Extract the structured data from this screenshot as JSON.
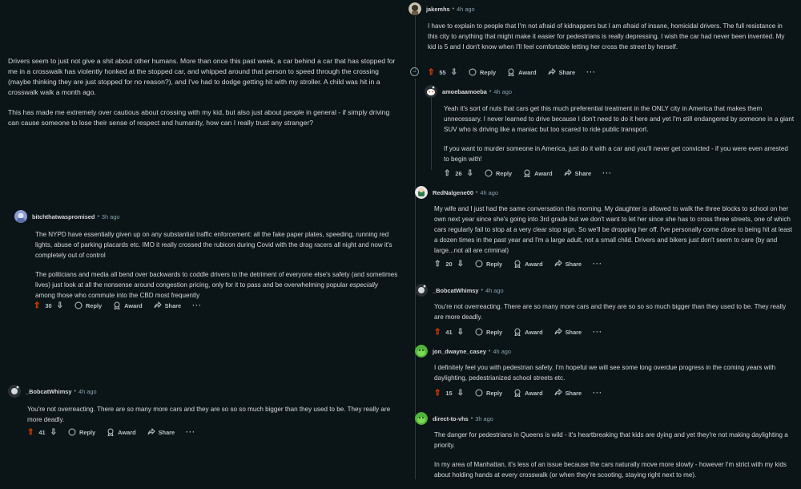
{
  "post": {
    "paragraphs": [
      "Drivers seem to just not give a shit about other humans. More than once this past week, a car behind a car that has stopped for me in a crosswalk has violently honked at the stopped car, and whipped around that person to speed through the crossing (maybe thinking they are just stopped for no reason?), and I've had to dodge getting hit with my stroller. A child was hit in a crosswalk walk a month ago.",
      "This has made me extremely over cautious about crossing with my kid, but also just about people in general - if simply driving can cause someone to lose their sense of respect and humanity, how can I really trust any stranger?"
    ]
  },
  "labels": {
    "reply": "Reply",
    "award": "Award",
    "share": "Share",
    "more": "···",
    "dot": "•",
    "collapse": "−"
  },
  "left_comments": [
    {
      "username": "bitchthatwaspromised",
      "time": "3h ago",
      "p1": "The NYPD have essentially given up on any substantial traffic enforcement: all the fake paper plates, speeding, running red lights, abuse of parking placards etc. IMO it really crossed the rubicon during Covid with the drag racers all night and now it's completely out of control",
      "p2a": "The politicians and media all bend over backwards to coddle drivers to the detriment of everyone else's safety (and sometimes lives) just look at all the nonsense around congestion pricing, only for it to pass and be overwhelming popular ",
      "p2em": "especially",
      "p2b": " among those who commute into the CBD most frequently",
      "votes": "30"
    },
    {
      "username": "_BobcatWhimsy",
      "time": "4h ago",
      "p1": "You're not overreacting. There are so many more cars and they are so so so much bigger than they used to be. They really are more deadly.",
      "votes": "41"
    }
  ],
  "right_comments": [
    {
      "username": "jakemhs",
      "time": "4h ago",
      "p1": "I have to explain to people that I'm not afraid of kidnappers but I am afraid of insane, homicidal drivers. The full resistance in this city to anything that might make it easier for pedestrians is really depressing. I wish the car had never been invented. My kid is 5 and I don't know when I'll feel comfortable letting her cross the street by herself.",
      "votes": "55"
    },
    {
      "username": "amoebaamoeba",
      "time": "4h ago",
      "p1": "Yeah it's sort of nuts that cars get this much preferential treatment in the ONLY city in America that makes them unnecessary. I never learned to drive because I don't need to do it here and yet I'm still endangered by someone in a giant SUV who is driving like a maniac but too scared to ride public transport.",
      "p2": "If you want to murder someone in America, just do it with a car and you'll never get convicted - if you were even arrested to begin with!",
      "votes": "26"
    },
    {
      "username": "RedNalgene00",
      "time": "4h ago",
      "p1": "My wife and I just had the same conversation this morning. My daughter is allowed to walk the three blocks to school on her own next year since she's going into 3rd grade but we don't want to let her since she has to cross three streets, one of which cars regularly fail to stop at a very clear stop sign. So we'll be dropping her off. I've personally come close to being hit at least a dozen times in the past year and I'm a large adult, not a small child. Drivers and bikers just don't seem to care (by and large...not all are criminal)",
      "votes": "20"
    },
    {
      "username": "_BobcatWhimsy",
      "time": "4h ago",
      "p1": "You're not overreacting. There are so many more cars and they are so so so much bigger than they used to be. They really are more deadly.",
      "votes": "41"
    },
    {
      "username": "jon_dwayne_casey",
      "time": "4h ago",
      "p1": "I definitely feel you with pedestrian safety. I'm hopeful we will see some long overdue progress in the coming years with daylighting, pedestrianized school streets etc.",
      "votes": "15"
    },
    {
      "username": "direct-to-vhs",
      "time": "3h ago",
      "p1": "The danger for pedestrians in Queens is wild - it's heartbreaking that kids are dying and yet they're not making daylighting a priority.",
      "p2": "In my area of Manhattan, it's less of an issue because the cars naturally move more slowly - however I'm strict with my kids about holding hands at every crosswalk (or when they're scooting, staying right next to me)."
    }
  ],
  "colors": {
    "upvote": "#ff4500",
    "background": "#0b1416",
    "text": "#d7dadc",
    "meta": "#8ba2ad"
  }
}
